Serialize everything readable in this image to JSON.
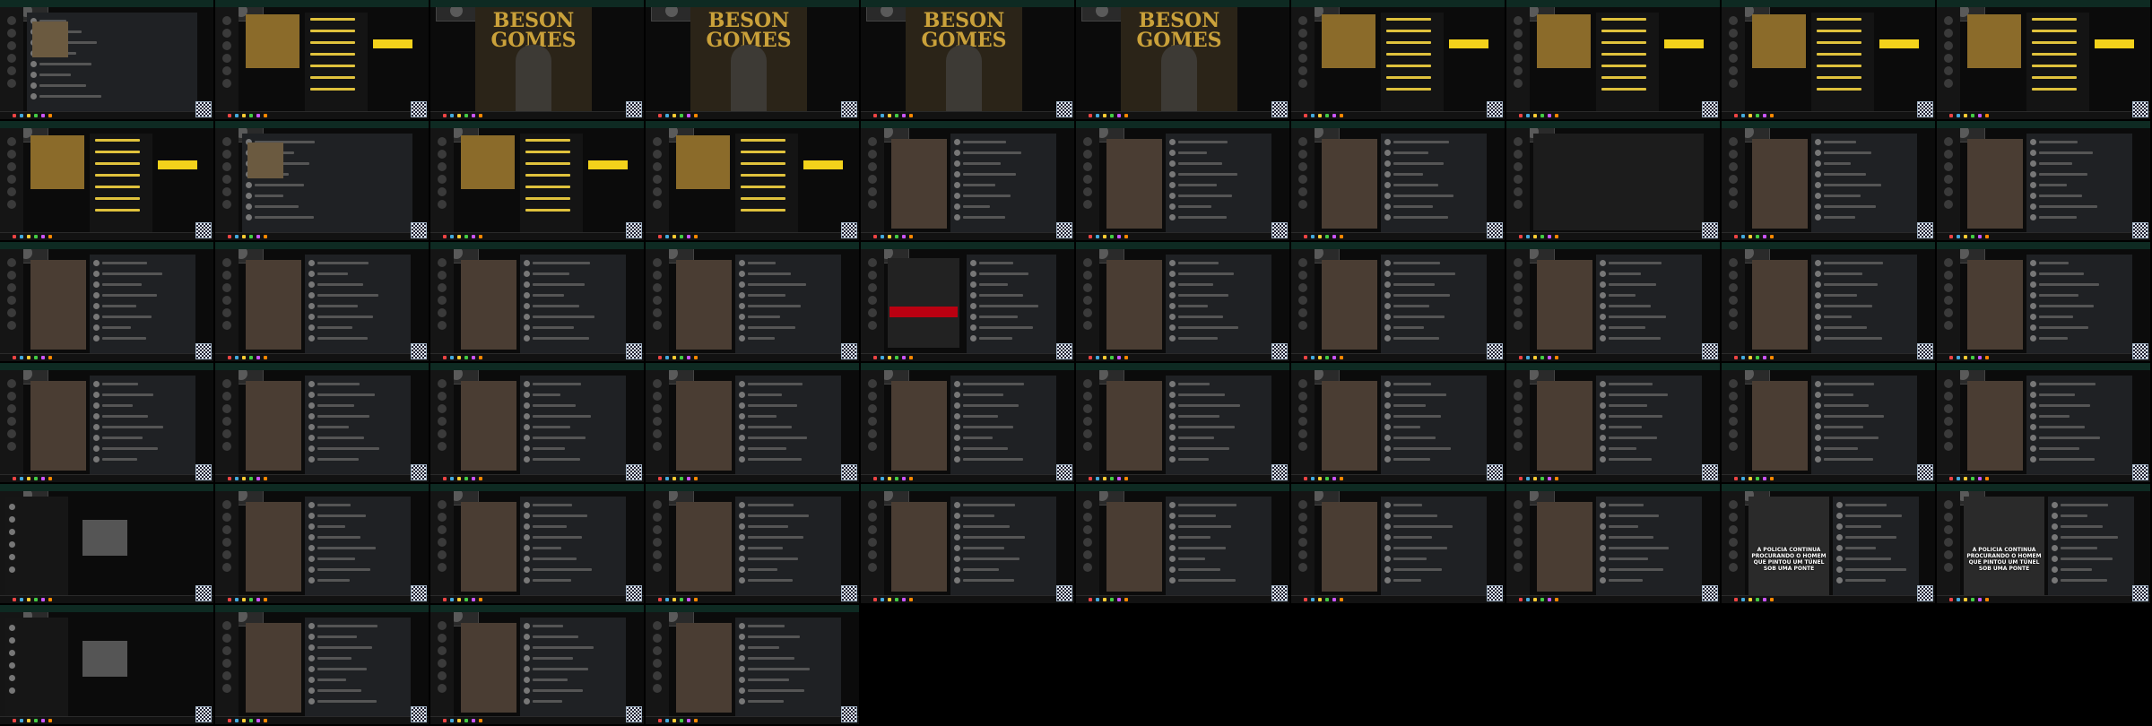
{
  "tiles": [
    {
      "kind": "feed-dark",
      "overlay": null
    },
    {
      "kind": "music-light",
      "overlay": null
    },
    {
      "kind": "album-full",
      "overlay": "BESON GOMES"
    },
    {
      "kind": "album-full",
      "overlay": "BESON GOMES"
    },
    {
      "kind": "album-full",
      "overlay": "BESON GOMES"
    },
    {
      "kind": "album-full",
      "overlay": "BESON GOMES"
    },
    {
      "kind": "music-light",
      "overlay": null
    },
    {
      "kind": "music-light",
      "overlay": null
    },
    {
      "kind": "music-light",
      "overlay": null
    },
    {
      "kind": "music-light",
      "overlay": null
    },
    {
      "kind": "playlist",
      "overlay": null
    },
    {
      "kind": "comments",
      "overlay": null
    },
    {
      "kind": "playlist",
      "overlay": null
    },
    {
      "kind": "playlist",
      "overlay": null
    },
    {
      "kind": "social",
      "overlay": null
    },
    {
      "kind": "social",
      "overlay": null
    },
    {
      "kind": "social",
      "overlay": null
    },
    {
      "kind": "blank-dark",
      "overlay": null
    },
    {
      "kind": "social",
      "overlay": null
    },
    {
      "kind": "social",
      "overlay": null
    },
    {
      "kind": "social",
      "overlay": null
    },
    {
      "kind": "social",
      "overlay": null
    },
    {
      "kind": "social",
      "overlay": null
    },
    {
      "kind": "social",
      "overlay": null
    },
    {
      "kind": "news",
      "overlay": null
    },
    {
      "kind": "social",
      "overlay": null
    },
    {
      "kind": "social",
      "overlay": null
    },
    {
      "kind": "social",
      "overlay": null
    },
    {
      "kind": "social",
      "overlay": null
    },
    {
      "kind": "social",
      "overlay": null
    },
    {
      "kind": "social",
      "overlay": null
    },
    {
      "kind": "social",
      "overlay": null
    },
    {
      "kind": "social",
      "overlay": null
    },
    {
      "kind": "social",
      "overlay": null
    },
    {
      "kind": "social",
      "overlay": null
    },
    {
      "kind": "social",
      "overlay": null
    },
    {
      "kind": "social",
      "overlay": null
    },
    {
      "kind": "social",
      "overlay": null
    },
    {
      "kind": "social",
      "overlay": null
    },
    {
      "kind": "social",
      "overlay": null
    },
    {
      "kind": "profile",
      "overlay": null
    },
    {
      "kind": "social",
      "overlay": null
    },
    {
      "kind": "social",
      "overlay": null
    },
    {
      "kind": "social",
      "overlay": null
    },
    {
      "kind": "social",
      "overlay": null
    },
    {
      "kind": "social",
      "overlay": null
    },
    {
      "kind": "social",
      "overlay": null
    },
    {
      "kind": "social",
      "overlay": null
    },
    {
      "kind": "caption",
      "overlay": "A POLICIA CONTINUA PROCURANDO O HOMEM QUE PINTOU UM TÚNEL SOB UMA PONTE"
    },
    {
      "kind": "caption",
      "overlay": "A POLICIA CONTINUA PROCURANDO O HOMEM QUE PINTOU UM TÚNEL SOB UMA PONTE"
    },
    {
      "kind": "profile",
      "overlay": null
    },
    {
      "kind": "social",
      "overlay": null
    },
    {
      "kind": "social",
      "overlay": null
    },
    {
      "kind": "social",
      "overlay": null
    }
  ],
  "colors": {
    "window_bar": "#0e2a22",
    "panel": "#1f2124",
    "accent_yellow": "#f3d21b",
    "news_red": "#b01",
    "taskbar_icons": [
      "#e44",
      "#4ad",
      "#fc3",
      "#4c4",
      "#c5f",
      "#f80"
    ]
  }
}
